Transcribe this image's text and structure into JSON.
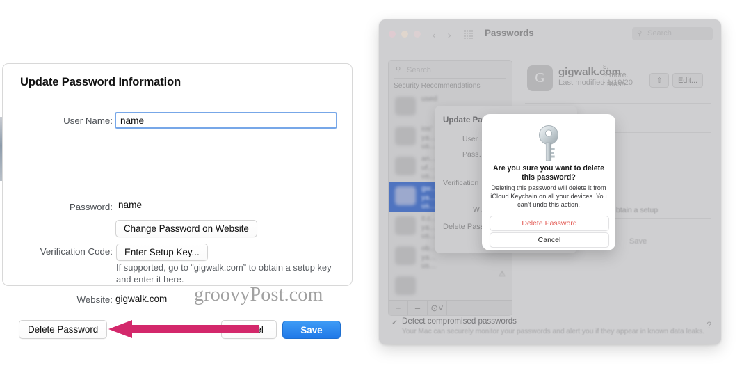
{
  "left_sheet": {
    "title": "Update Password Information",
    "fields": {
      "username_label": "User Name:",
      "username_value": "name",
      "password_label": "Password:",
      "password_value": "name",
      "verification_label": "Verification Code:",
      "website_label": "Website:",
      "website_value": "gigwalk.com"
    },
    "buttons": {
      "change_password": "Change Password on Website",
      "enter_setup_key": "Enter Setup Key...",
      "delete_password": "Delete Password",
      "cancel": "Cancel",
      "save": "Save"
    },
    "hint": "If supported, go to “gigwalk.com” to obtain a setup key and enter it here.",
    "watermark": "groovyPost.com",
    "accent_blue": "#2F8BF0",
    "focus_ring": "#77A7E8",
    "annotation_arrow_color": "#D3286B"
  },
  "mac_window": {
    "titlebar": {
      "title": "Passwords",
      "back_glyph": "‹",
      "forward_glyph": "›",
      "search_placeholder": "Search"
    },
    "sidebar": {
      "search_placeholder": "Search",
      "section_header": "Security Recommendations",
      "rows": [
        {
          "line1": "used",
          "line2": "",
          "line3": "",
          "selected": false
        },
        {
          "line1": "ios’",
          "line2": "ya…",
          "line3": "us…",
          "selected": false
        },
        {
          "line1": "an…",
          "line2": "uf…",
          "line3": "us…",
          "selected": false
        },
        {
          "line1": "gw…",
          "line2": "ya…",
          "line3": "us…",
          "selected": true
        },
        {
          "line1": "it.c…",
          "line2": "ya…",
          "line3": "us…",
          "selected": false
        },
        {
          "line1": "ob…",
          "line2": "ya…",
          "line3": "us…",
          "selected": false
        },
        {
          "line1": "",
          "line2": "",
          "line3": "",
          "selected": false
        }
      ],
      "toolbar": {
        "add": "+",
        "remove": "–",
        "action": "⊙˅"
      },
      "warning_glyph": "⚠"
    },
    "detail": {
      "site_initial": "G",
      "site_title": "gigwalk.com",
      "site_subtitle": "Last modified 1/19/20",
      "share_glyph": "⇧",
      "edit_label": "Edit...",
      "fragments": [
        "s,",
        "9 more.",
        "f those"
      ]
    },
    "preferences": {
      "check_glyph": "✓",
      "detect_label": "Detect compromised passwords",
      "detect_sub": "Your Mac can securely monitor your passwords and alert you if they appear in known data leaks.",
      "help_glyph": "?"
    },
    "mini_sheet": {
      "title": "Update Pas…",
      "line1": "User …",
      "line2": "Pass…",
      "line3": "Verification",
      "line4": "W…",
      "line5": "Delete Passw…",
      "save_label": "Save",
      "hint_fragment": "btain a setup"
    },
    "alert": {
      "title": "Are you sure you want to delete this password?",
      "body": "Deleting this password will delete it from iCloud Keychain on all your devices. You can’t undo this action.",
      "delete_label": "Delete Password",
      "cancel_label": "Cancel",
      "delete_color": "#E2554E",
      "icon": "key-icon"
    }
  }
}
